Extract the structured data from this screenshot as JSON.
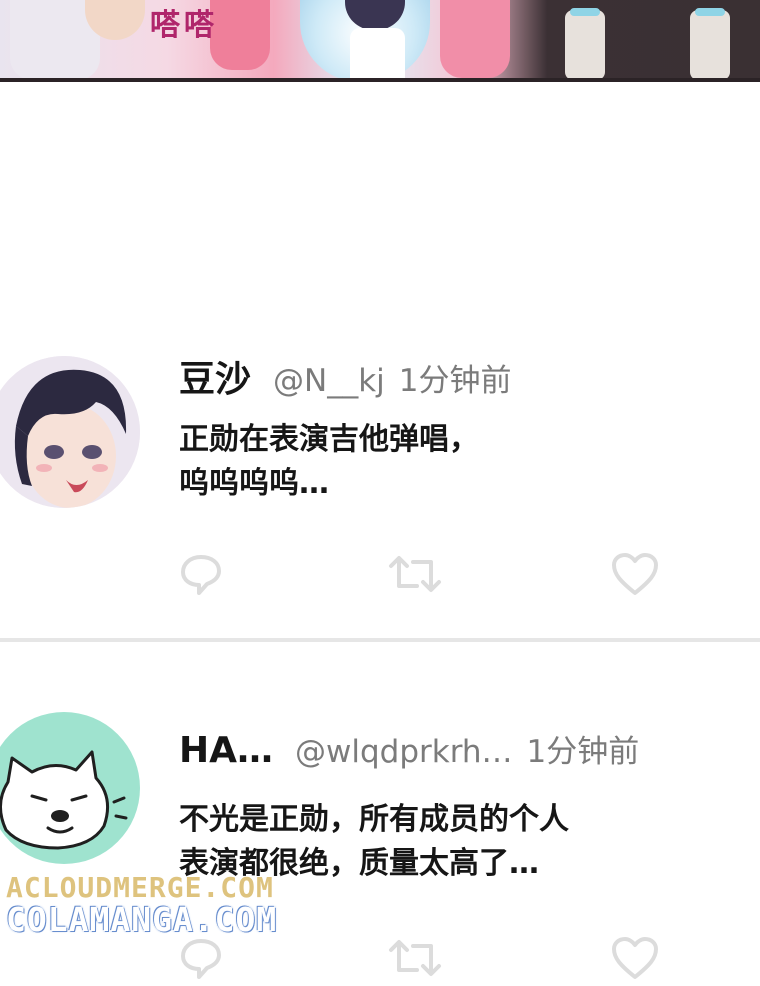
{
  "comic_panel": {
    "sfx": "嗒嗒"
  },
  "posts": [
    {
      "display_name": "豆沙",
      "handle": "@N__kj",
      "time": "1分钟前",
      "lines": [
        "正勋在表演吉他弹唱，",
        "呜呜呜呜…"
      ],
      "avatar_icon": "anime-boy-avatar"
    },
    {
      "display_name": "HA…",
      "handle": "@wlqdprkrh…",
      "time": "1分钟前",
      "lines": [
        "不光是正勋，所有成员的个人",
        "表演都很绝，质量太高了…"
      ],
      "avatar_icon": "white-dog-avatar",
      "avatar_bg": "#9fe3cf"
    }
  ],
  "actions": {
    "reply_icon": "reply-icon",
    "retweet_icon": "retweet-icon",
    "like_icon": "heart-icon",
    "icon_color": "#dcdcdc"
  },
  "watermark": {
    "line1": "ACLOUDMERGE.COM",
    "line2": "COLAMANGA.COM"
  }
}
